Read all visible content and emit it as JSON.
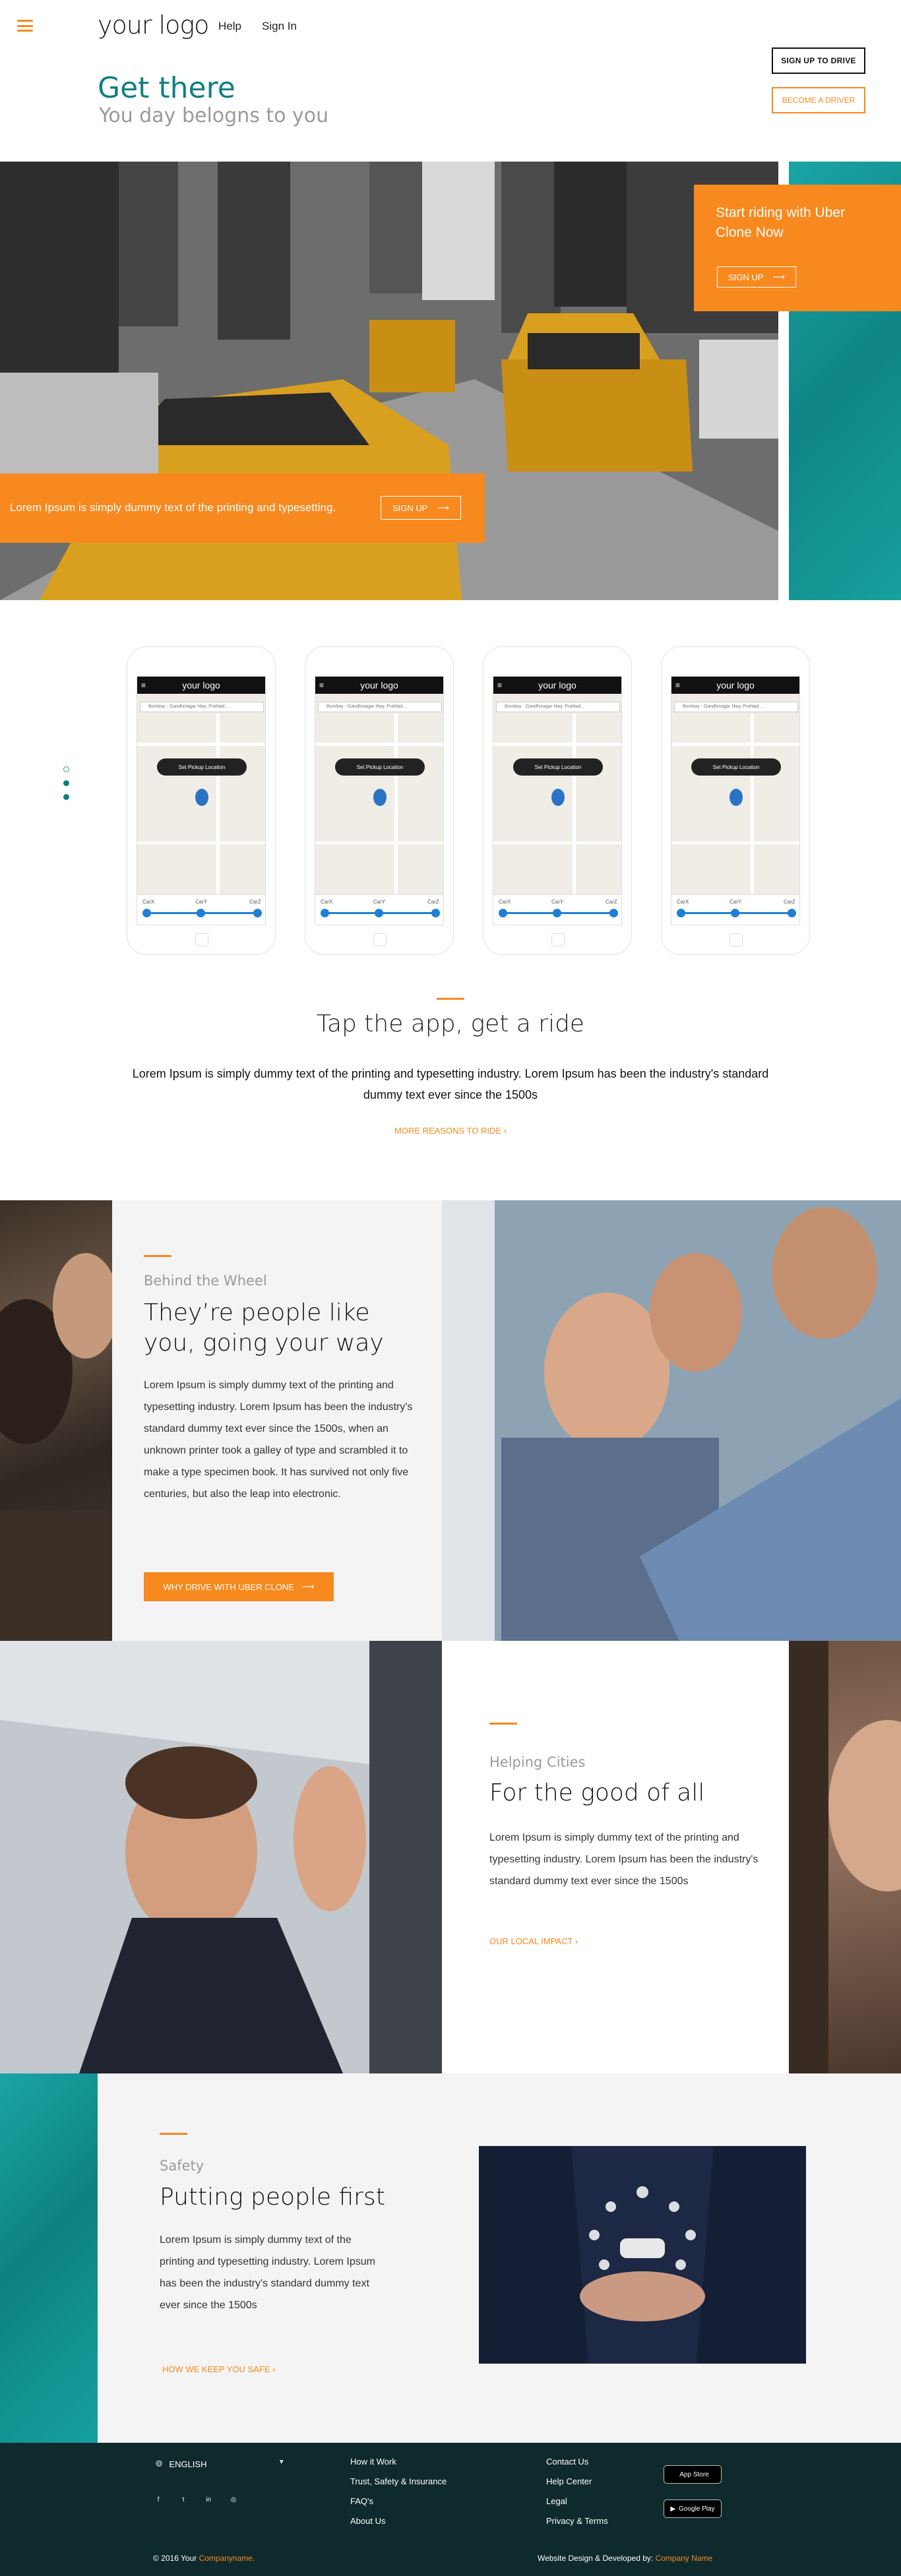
{
  "header": {
    "logo_text": "your logo",
    "nav": [
      "Help",
      "Sign In"
    ],
    "sign_up_drive": "SIGN UP TO DRIVE",
    "become_driver": "BECOME A DRIVER"
  },
  "hero": {
    "title": "Get there",
    "subtitle": "You day belogns to you",
    "cta_box_text": "Start riding with Uber Clone Now",
    "cta_box_button": "SIGN UP",
    "bar_text": "Lorem Ipsum is simply dummy text of the printing and typesetting.",
    "bar_button": "SIGN UP"
  },
  "app_screens": {
    "phones": [
      {
        "logo": "your logo",
        "search": "Bombay - Gandhinagar Hwy, Prahlad...",
        "pill": "Set Pickup Location",
        "cars": [
          "CarX",
          "CarY",
          "CarZ"
        ]
      },
      {
        "logo": "your logo",
        "search": "Bombay - Gandhinagar Hwy, Prahlad...",
        "pill": "Set Pickup Location",
        "cars": [
          "CarX",
          "CarY",
          "CarZ"
        ]
      },
      {
        "logo": "your logo",
        "search": "Bombay - Gandhinagar Hwy, Prahlad...",
        "pill": "Set Pickup Location",
        "cars": [
          "CarX",
          "CarY",
          "CarZ"
        ]
      },
      {
        "logo": "your logo",
        "search": "Bombay - Gandhinagar Hwy, Prahlad...",
        "pill": "Set Pickup Location",
        "cars": [
          "CarX",
          "CarY",
          "CarZ"
        ]
      }
    ],
    "title": "Tap the app, get a ride",
    "text": "Lorem Ipsum is simply dummy text of the printing and typesetting industry. Lorem Ipsum has been the industry's standard dummy text ever since the 1500s",
    "link": "MORE REASONS TO RIDE"
  },
  "behind_wheel": {
    "kicker": "Behind the Wheel",
    "title": "They’re people like you, going your way",
    "text": "Lorem Ipsum is simply dummy text of the printing and typesetting industry. Lorem Ipsum has been the industry's standard dummy text ever since the 1500s, when an unknown printer took a galley of type and scrambled it to make a type specimen book. It has survived not only five centuries, but also the leap into electronic.",
    "button": "WHY DRIVE WITH UBER CLONE"
  },
  "helping_cities": {
    "kicker": "Helping Cities",
    "title": "For the good of all",
    "text": "Lorem Ipsum is simply dummy text of the printing and typesetting industry. Lorem Ipsum has been the industry's standard dummy text ever since the 1500s",
    "link": "OUR LOCAL IMPACT"
  },
  "safety": {
    "kicker": "Safety",
    "title": "Putting people first",
    "text": "Lorem Ipsum is simply dummy text of the printing and typesetting industry. Lorem Ipsum has been the industry's standard dummy text ever since the 1500s",
    "link": "HOW WE KEEP YOU SAFE"
  },
  "footer": {
    "language": "ENGLISH",
    "col1": [
      "How it Work",
      "Trust, Safety & Insurance",
      "FAQ's",
      "About Us"
    ],
    "col2": [
      "Contact Us",
      "Help Center",
      "Legal",
      "Privacy & Terms"
    ],
    "app_store": "App Store",
    "google_play": "Google Play",
    "copyright_prefix": "© 2016 Your",
    "copyright_company": "Companyname.",
    "credit_prefix": "Website Design & Developed by:",
    "credit_company": "Company Name"
  },
  "colors": {
    "accent": "#f7891f",
    "teal": "#127f81",
    "footer_bg": "#0e2a2c"
  },
  "icons": [
    "menu-icon",
    "arrow-right-icon",
    "globe-icon",
    "facebook-icon",
    "twitter-icon",
    "linkedin-icon",
    "instagram-icon",
    "apple-icon",
    "google-play-icon"
  ]
}
